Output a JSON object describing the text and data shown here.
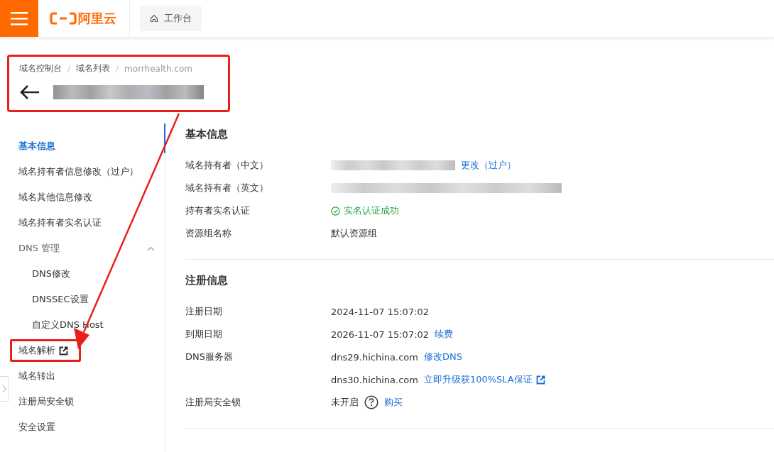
{
  "top_bar": {
    "brand": "阿里云",
    "workbench_button": "工作台"
  },
  "page_header": {
    "highlighted": true,
    "separator": "/",
    "breadcrumbs": [
      "域名控制台",
      "域名列表",
      "morrhealth.com"
    ]
  },
  "sidebar": {
    "items": [
      {
        "label": "基本信息",
        "selected": true,
        "highlighted": false,
        "external": false
      },
      {
        "label": "域名持有者信息修改（过户）",
        "selected": false,
        "highlighted": false,
        "external": false
      },
      {
        "label": "域名其他信息修改",
        "selected": false,
        "highlighted": false,
        "external": false
      },
      {
        "label": "域名持有者实名认证",
        "selected": false,
        "highlighted": false,
        "external": false
      },
      {
        "label": "DNS 管理",
        "selected": false,
        "highlighted": false,
        "external": false,
        "expanded": true,
        "children": [
          {
            "label": "DNS修改",
            "selected": false
          },
          {
            "label": "DNSSEC设置",
            "selected": false
          },
          {
            "label": "自定义DNS Host",
            "selected": false
          }
        ]
      },
      {
        "label": "域名解析",
        "selected": false,
        "highlighted": true,
        "external": true
      },
      {
        "label": "域名转出",
        "selected": false,
        "highlighted": false,
        "external": false
      },
      {
        "label": "注册局安全锁",
        "selected": false,
        "highlighted": false,
        "external": false
      },
      {
        "label": "安全设置",
        "selected": false,
        "highlighted": false,
        "external": false
      }
    ]
  },
  "sections": [
    {
      "title": "基本信息",
      "rows": [
        {
          "label": "域名持有者（中文）",
          "values": [
            [
              {
                "kind": "redacted"
              },
              {
                "kind": "link",
                "text": "更改（过户）"
              }
            ]
          ]
        },
        {
          "label": "域名持有者（英文）",
          "values": [
            [
              {
                "kind": "redacted"
              }
            ]
          ]
        },
        {
          "label": "持有者实名认证",
          "values": [
            [
              {
                "kind": "status",
                "text": "实名认证成功"
              }
            ]
          ]
        },
        {
          "label": "资源组名称",
          "values": [
            [
              {
                "kind": "text",
                "text": "默认资源组"
              }
            ]
          ]
        }
      ]
    },
    {
      "title": "注册信息",
      "rows": [
        {
          "label": "注册日期",
          "values": [
            [
              {
                "kind": "text",
                "text": "2024-11-07 15:07:02"
              }
            ]
          ]
        },
        {
          "label": "到期日期",
          "values": [
            [
              {
                "kind": "text",
                "text": "2026-11-07 15:07:02"
              },
              {
                "kind": "link",
                "text": "续费"
              }
            ]
          ]
        },
        {
          "label": "DNS服务器",
          "values": [
            [
              {
                "kind": "text",
                "text": "dns29.hichina.com"
              },
              {
                "kind": "link",
                "text": "修改DNS"
              }
            ],
            [
              {
                "kind": "text",
                "text": "dns30.hichina.com"
              },
              {
                "kind": "external_link",
                "text": "立即升级获100%SLA保证"
              }
            ]
          ]
        },
        {
          "label": "注册局安全锁",
          "values": [
            [
              {
                "kind": "text",
                "text": "未开启"
              },
              {
                "kind": "help"
              },
              {
                "kind": "link",
                "text": "购买"
              }
            ]
          ]
        }
      ]
    }
  ]
}
